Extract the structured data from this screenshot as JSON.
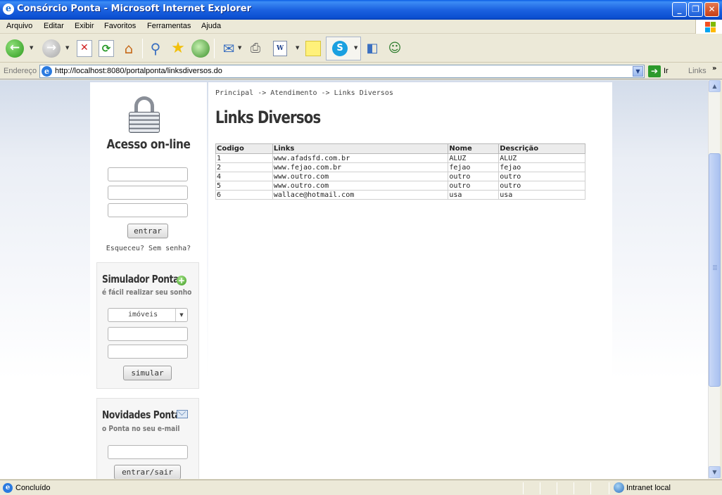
{
  "window": {
    "title": "Consórcio Ponta - Microsoft Internet Explorer",
    "minimize": "_",
    "maximize": "❐",
    "close": "✕"
  },
  "menu": [
    "Arquivo",
    "Editar",
    "Exibir",
    "Favoritos",
    "Ferramentas",
    "Ajuda"
  ],
  "address": {
    "label": "Endereço",
    "url": "http://localhost:8080/portalponta/linksdiversos.do",
    "go_label": "Ir",
    "links_label": "Links"
  },
  "sidebar": {
    "acesso_title": "Acesso on-line",
    "entrar_button": "entrar",
    "esqueceu_text": "Esqueceu? Sem senha?",
    "simulador": {
      "title": "Simulador Ponta",
      "subtitle": "é fácil realizar seu sonho",
      "select_value": "imóveis",
      "button": "simular"
    },
    "novidades": {
      "title": "Novidades Ponta",
      "subtitle": "o Ponta no seu e-mail",
      "button": "entrar/sair"
    }
  },
  "main": {
    "breadcrumb": "Principal -> Atendimento -> Links Diversos",
    "title": "Links Diversos",
    "table": {
      "headers": [
        "Codigo",
        "Links",
        "Nome",
        "Descrição"
      ],
      "rows": [
        [
          "1",
          "www.afadsfd.com.br",
          "ALUZ",
          "ALUZ"
        ],
        [
          "2",
          "www.fejao.com.br",
          "fejao",
          "fejao"
        ],
        [
          "4",
          "www.outro.com",
          "outro",
          "outro"
        ],
        [
          "5",
          "www.outro.com",
          "outro",
          "outro"
        ],
        [
          "6",
          "wallace@hotmail.com",
          "usa",
          "usa"
        ]
      ]
    }
  },
  "status": {
    "text": "Concluído",
    "zone": "Intranet local"
  }
}
